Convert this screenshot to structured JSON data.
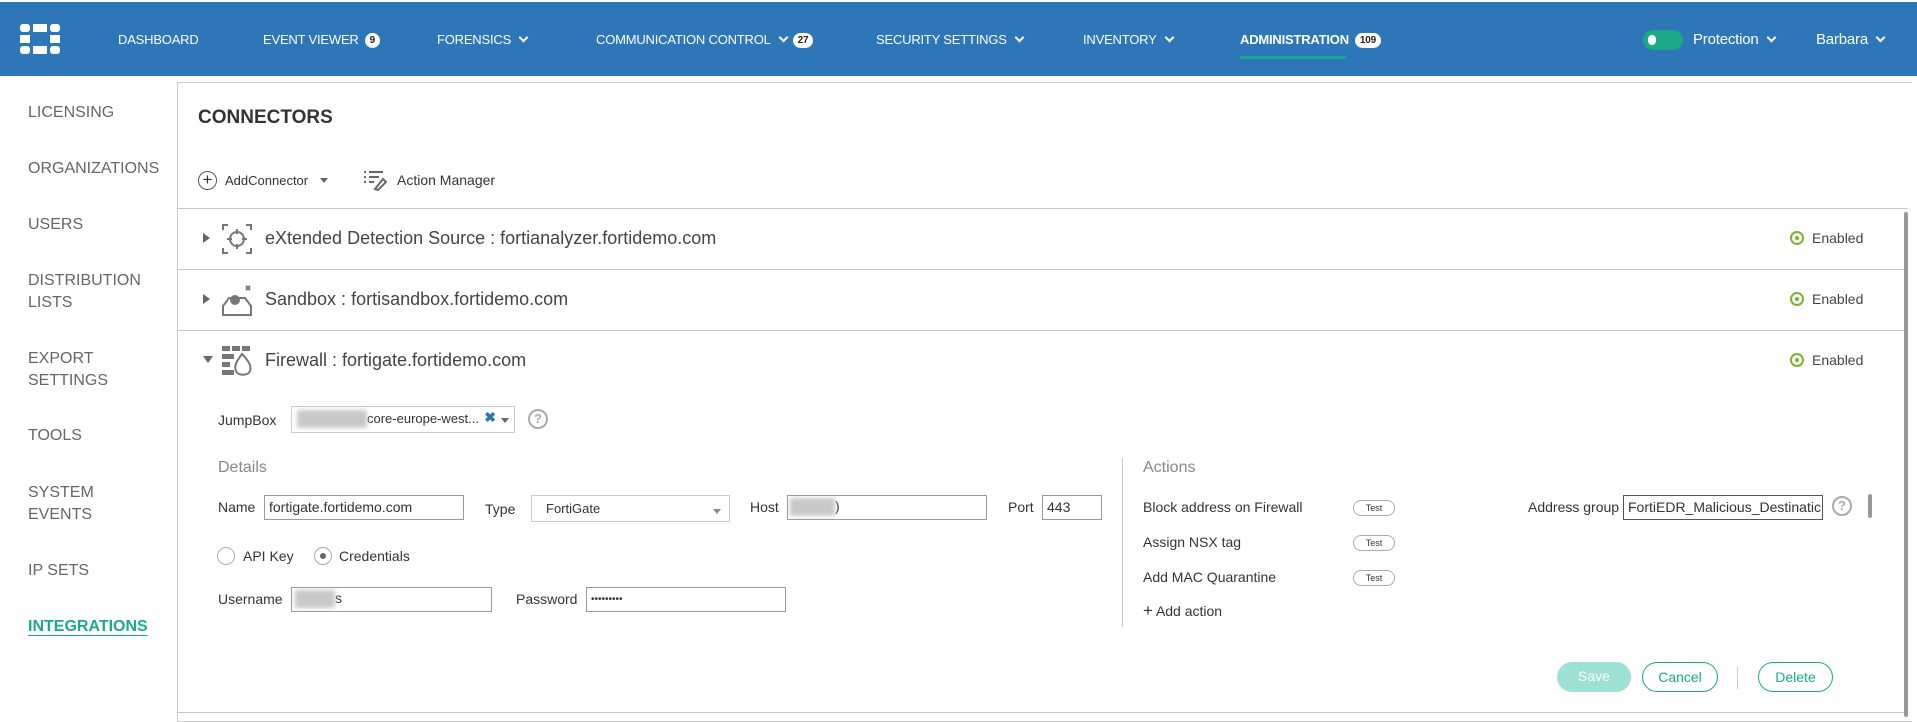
{
  "nav": {
    "items": [
      {
        "label": "DASHBOARD"
      },
      {
        "label": "EVENT VIEWER",
        "badge": "9"
      },
      {
        "label": "FORENSICS"
      },
      {
        "label": "COMMUNICATION CONTROL",
        "badge": "27"
      },
      {
        "label": "SECURITY SETTINGS"
      },
      {
        "label": "INVENTORY"
      },
      {
        "label": "ADMINISTRATION",
        "badge": "109"
      }
    ],
    "protection": "Protection",
    "user": "Barbara"
  },
  "sidebar": {
    "items": [
      {
        "label": "LICENSING"
      },
      {
        "label": "ORGANIZATIONS"
      },
      {
        "label": "USERS"
      },
      {
        "label": "DISTRIBUTION LISTS"
      },
      {
        "label": "EXPORT SETTINGS"
      },
      {
        "label": "TOOLS"
      },
      {
        "label": "SYSTEM EVENTS"
      },
      {
        "label": "IP SETS"
      },
      {
        "label": "INTEGRATIONS"
      }
    ]
  },
  "main": {
    "title": "CONNECTORS",
    "add_connector": "AddConnector",
    "action_manager": "Action Manager",
    "connectors": [
      {
        "title": "eXtended Detection Source : fortianalyzer.fortidemo.com",
        "status": "Enabled"
      },
      {
        "title": "Sandbox : fortisandbox.fortidemo.com",
        "status": "Enabled"
      },
      {
        "title": "Firewall : fortigate.fortidemo.com",
        "status": "Enabled"
      }
    ]
  },
  "form": {
    "jumpbox_label": "JumpBox",
    "jumpbox_value": "core-europe-west...",
    "details_label": "Details",
    "name_label": "Name",
    "name_value": "fortigate.fortidemo.com",
    "type_label": "Type",
    "type_value": "FortiGate",
    "host_label": "Host",
    "host_value": ")",
    "port_label": "Port",
    "port_value": "443",
    "api_key": "API Key",
    "credentials": "Credentials",
    "username_label": "Username",
    "username_value": "s",
    "password_label": "Password",
    "password_value": "•••••••••",
    "actions_label": "Actions",
    "actions": [
      {
        "label": "Block address on Firewall",
        "test": "Test"
      },
      {
        "label": "Assign NSX tag",
        "test": "Test"
      },
      {
        "label": "Add MAC Quarantine",
        "test": "Test"
      }
    ],
    "add_action": "Add action",
    "address_group_label": "Address group",
    "address_group_value": "FortiEDR_Malicious_Destinatic",
    "save": "Save",
    "cancel": "Cancel",
    "delete": "Delete"
  },
  "colors": {
    "nav": "#2d76b8",
    "accent": "#1aaa8a",
    "enabled": "#7ab32f"
  }
}
